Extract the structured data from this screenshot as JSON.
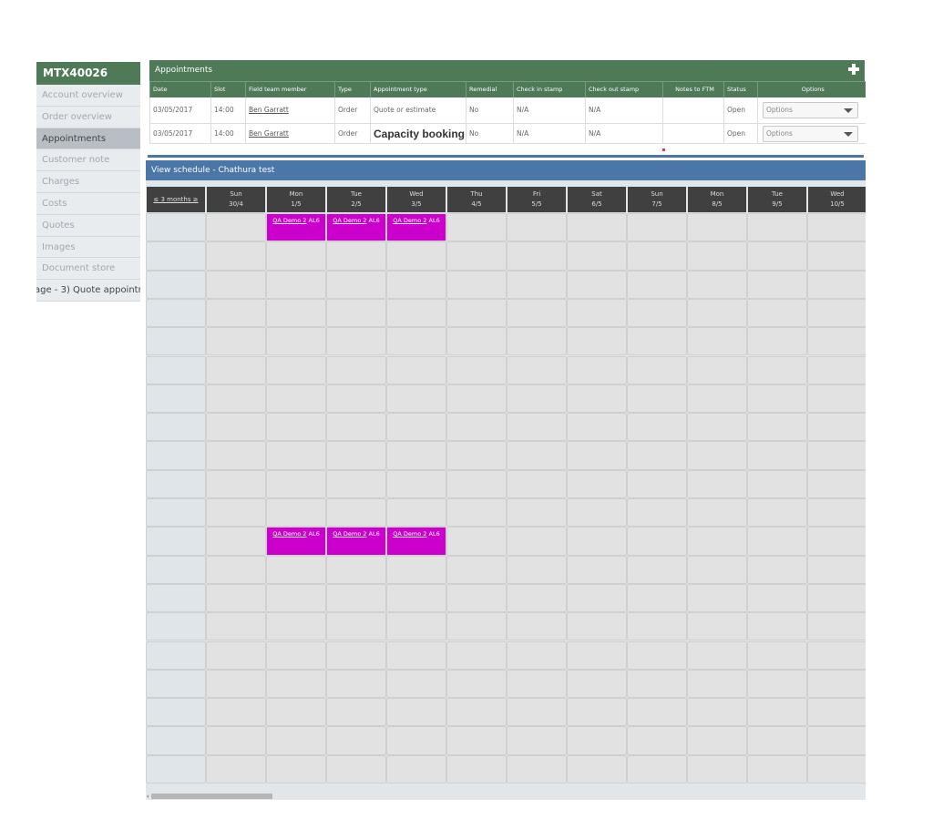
{
  "sidebar": {
    "title": "MTX40026",
    "items": [
      {
        "label": "Account overview",
        "active": false
      },
      {
        "label": "Order overview",
        "active": false
      },
      {
        "label": "Appointments",
        "active": true
      },
      {
        "label": "Customer note",
        "active": false
      },
      {
        "label": "Charges",
        "active": false
      },
      {
        "label": "Costs",
        "active": false
      },
      {
        "label": "Quotes",
        "active": false
      },
      {
        "label": "Images",
        "active": false
      },
      {
        "label": "Document store",
        "active": false
      }
    ],
    "overflow_text": "age - 3) Quote appointm"
  },
  "appointments": {
    "title": "Appointments",
    "add_icon": "plus-icon",
    "columns": [
      "Date",
      "Slot",
      "Field team member",
      "Type",
      "Appointment type",
      "Remedial",
      "Check in stamp",
      "Check out stamp",
      "Notes to FTM",
      "Status",
      "Options"
    ],
    "rows": [
      {
        "date": "03/05/2017",
        "slot": "14:00",
        "member": "Ben Garratt",
        "type": "Order",
        "appointment_type": "Quote or estimate",
        "remedial": "No",
        "check_in": "N/A",
        "check_out": "N/A",
        "notes": "",
        "status": "Open",
        "options": "Options"
      },
      {
        "date": "03/05/2017",
        "slot": "14:00",
        "member": "Ben Garratt",
        "type": "Order",
        "appointment_type": "Capacity booking",
        "remedial": "No",
        "check_in": "N/A",
        "check_out": "N/A",
        "notes": "",
        "status": "Open",
        "options": "Options"
      }
    ]
  },
  "schedule": {
    "title": "View schedule - Chathura test",
    "nav_label": "≤ 3 months ≥",
    "days": [
      {
        "day": "Sun",
        "date": "30/4"
      },
      {
        "day": "Mon",
        "date": "1/5"
      },
      {
        "day": "Tue",
        "date": "2/5"
      },
      {
        "day": "Wed",
        "date": "3/5"
      },
      {
        "day": "Thu",
        "date": "4/5"
      },
      {
        "day": "Fri",
        "date": "5/5"
      },
      {
        "day": "Sat",
        "date": "6/5"
      },
      {
        "day": "Sun",
        "date": "7/5"
      },
      {
        "day": "Mon",
        "date": "8/5"
      },
      {
        "day": "Tue",
        "date": "9/5"
      },
      {
        "day": "Wed",
        "date": "10/5"
      }
    ],
    "row_count": 20,
    "events": [
      {
        "row": 0,
        "day": 1,
        "link": "QA Demo 2",
        "suffix": "AL6"
      },
      {
        "row": 0,
        "day": 2,
        "link": "QA Demo 2",
        "suffix": "AL6"
      },
      {
        "row": 0,
        "day": 3,
        "link": "QA Demo 2",
        "suffix": "AL6"
      },
      {
        "row": 11,
        "day": 1,
        "link": "QA Demo 2",
        "suffix": "AL6"
      },
      {
        "row": 11,
        "day": 2,
        "link": "QA Demo 2",
        "suffix": "AL6"
      },
      {
        "row": 11,
        "day": 3,
        "link": "QA Demo 2",
        "suffix": "AL6"
      }
    ],
    "event_color": "#cc00cc"
  }
}
